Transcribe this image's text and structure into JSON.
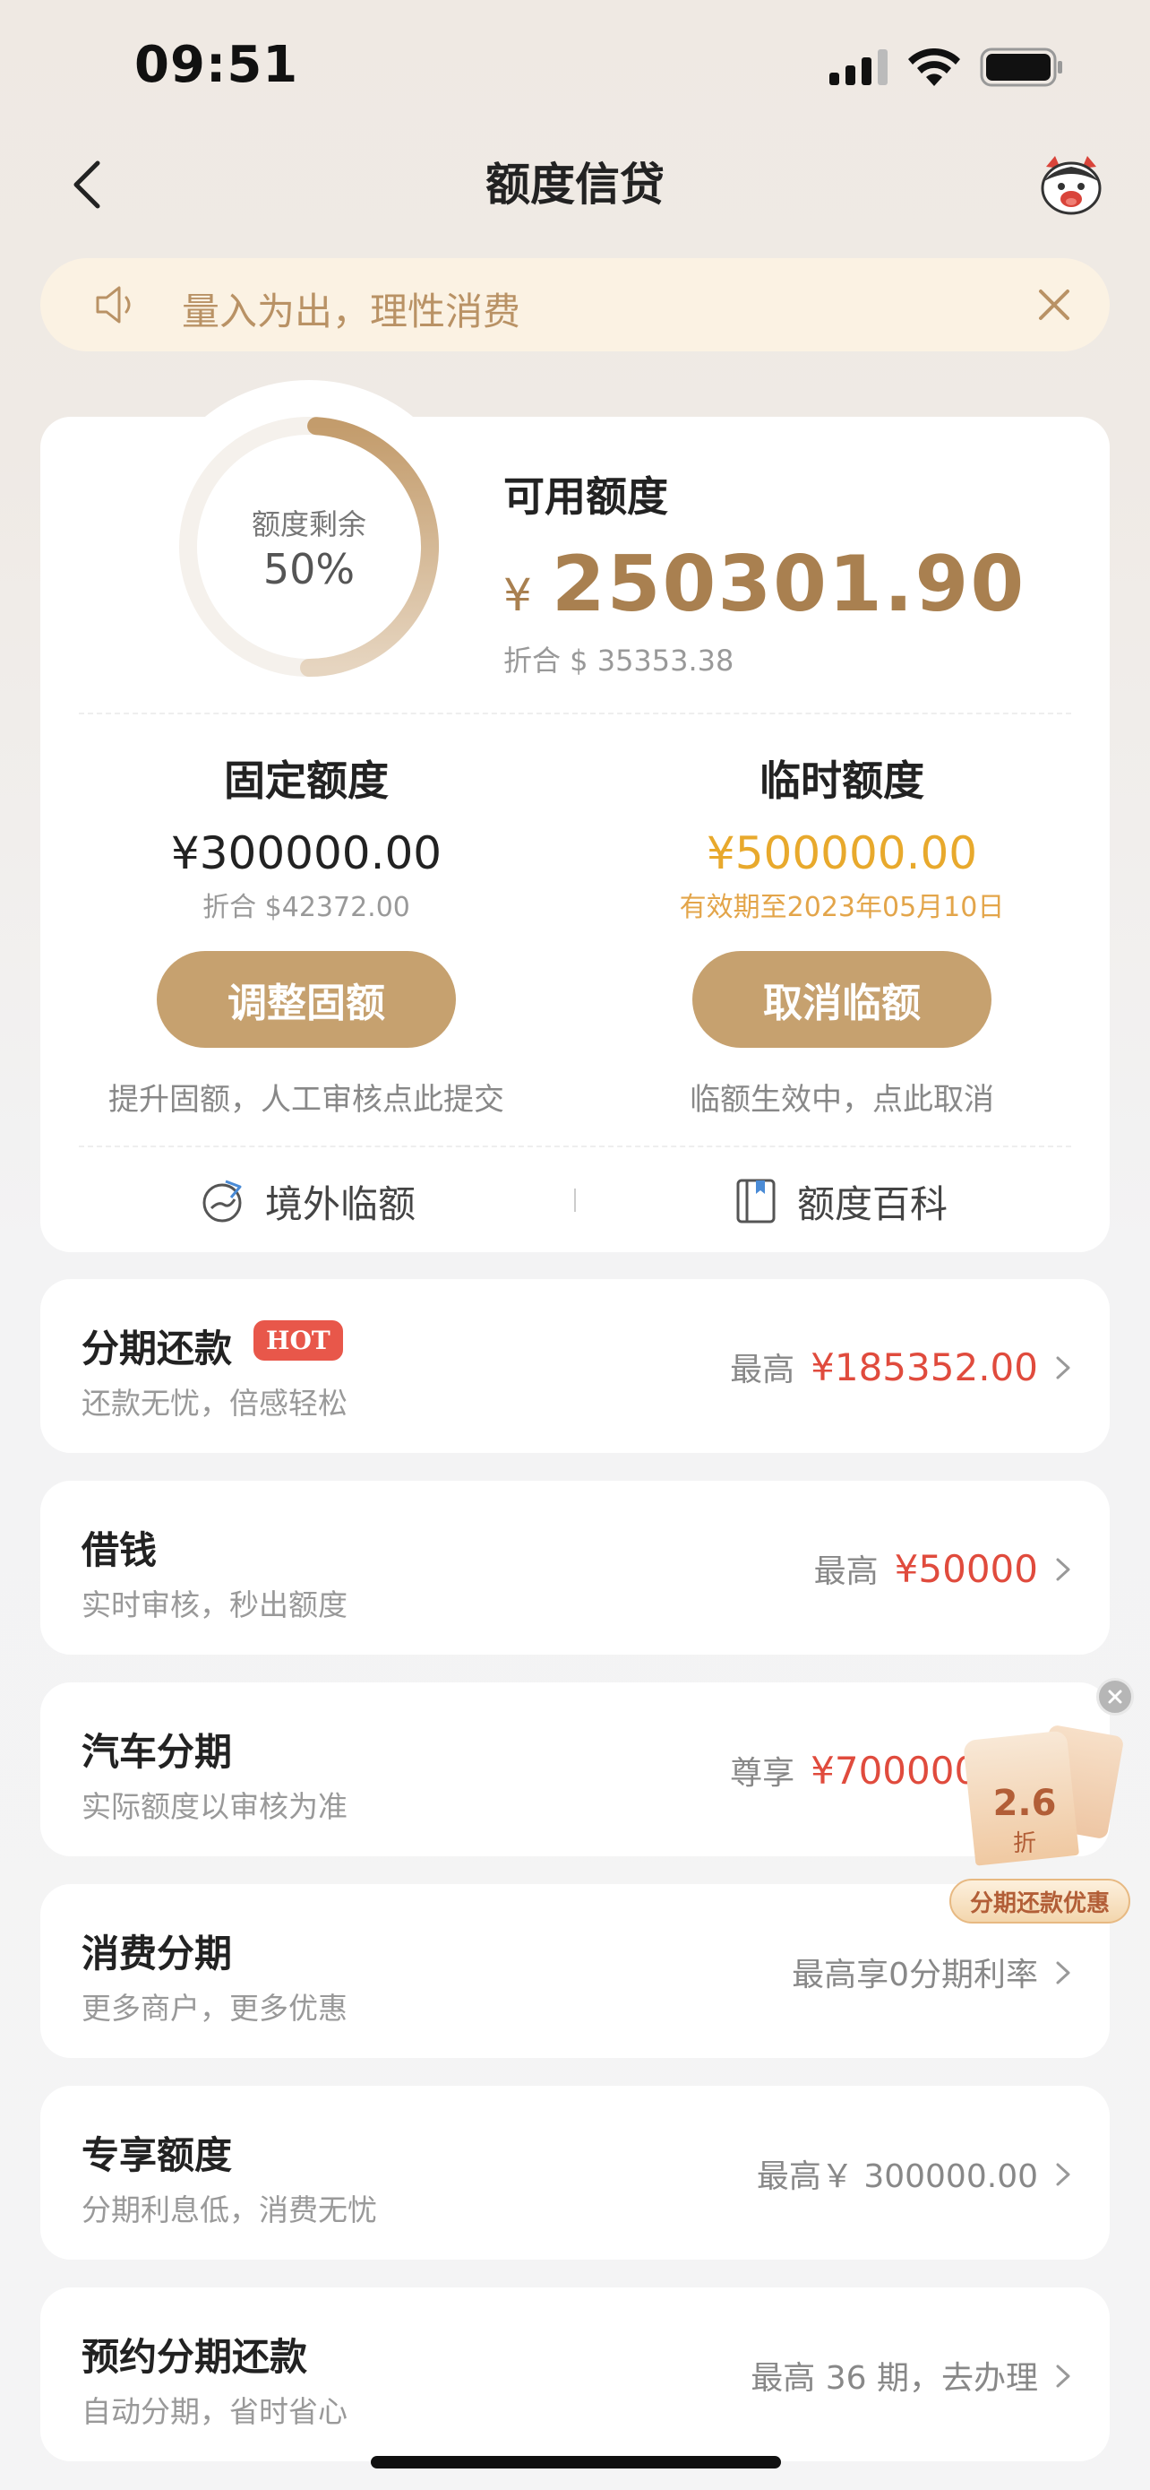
{
  "status_bar": {
    "time": "09:51"
  },
  "nav": {
    "title": "额度信贷"
  },
  "notice": {
    "text": "量入为出，理性消费"
  },
  "credit": {
    "ring_label": "额度剩余",
    "ring_value": "50%",
    "ring_fraction": 0.5,
    "available_label": "可用额度",
    "currency_symbol": "¥",
    "available_amount": "250301.90",
    "available_usd": "折合 $ 35353.38"
  },
  "fixed": {
    "title": "固定额度",
    "amount": "¥300000.00",
    "usd": "折合 $42372.00",
    "button": "调整固额",
    "hint": "提升固额，人工审核点此提交"
  },
  "temp": {
    "title": "临时额度",
    "amount": "¥500000.00",
    "validity": "有效期至2023年05月10日",
    "button": "取消临额",
    "hint": "临额生效中，点此取消"
  },
  "links": {
    "overseas": "境外临额",
    "wiki": "额度百科"
  },
  "rows": [
    {
      "title": "分期还款",
      "badge": "HOT",
      "subtitle": "还款无忧，倍感轻松",
      "prefix": "最高",
      "value": "¥185352.00"
    },
    {
      "title": "借钱",
      "subtitle": "实时审核，秒出额度",
      "prefix": "最高",
      "value": "¥50000"
    },
    {
      "title": "汽车分期",
      "subtitle": "实际额度以审核为准",
      "prefix": "尊享",
      "value": "¥700000.00"
    },
    {
      "title": "消费分期",
      "subtitle": "更多商户，更多优惠",
      "prefix": "最高享0分期利率",
      "value": ""
    },
    {
      "title": "专享额度",
      "subtitle": "分期利息低，消费无忧",
      "prefix": "最高￥ 300000.00",
      "value": ""
    },
    {
      "title": "预约分期还款",
      "subtitle": "自动分期，省时省心",
      "prefix": "最高 36 期，去办理",
      "value": ""
    }
  ],
  "promo": {
    "discount": "2.6",
    "discount_unit": "折",
    "label": "分期还款优惠"
  },
  "colors": {
    "accent": "#c6a16f",
    "amount_gold": "#a98050",
    "orange": "#e8a92c",
    "red": "#e04b3d"
  }
}
